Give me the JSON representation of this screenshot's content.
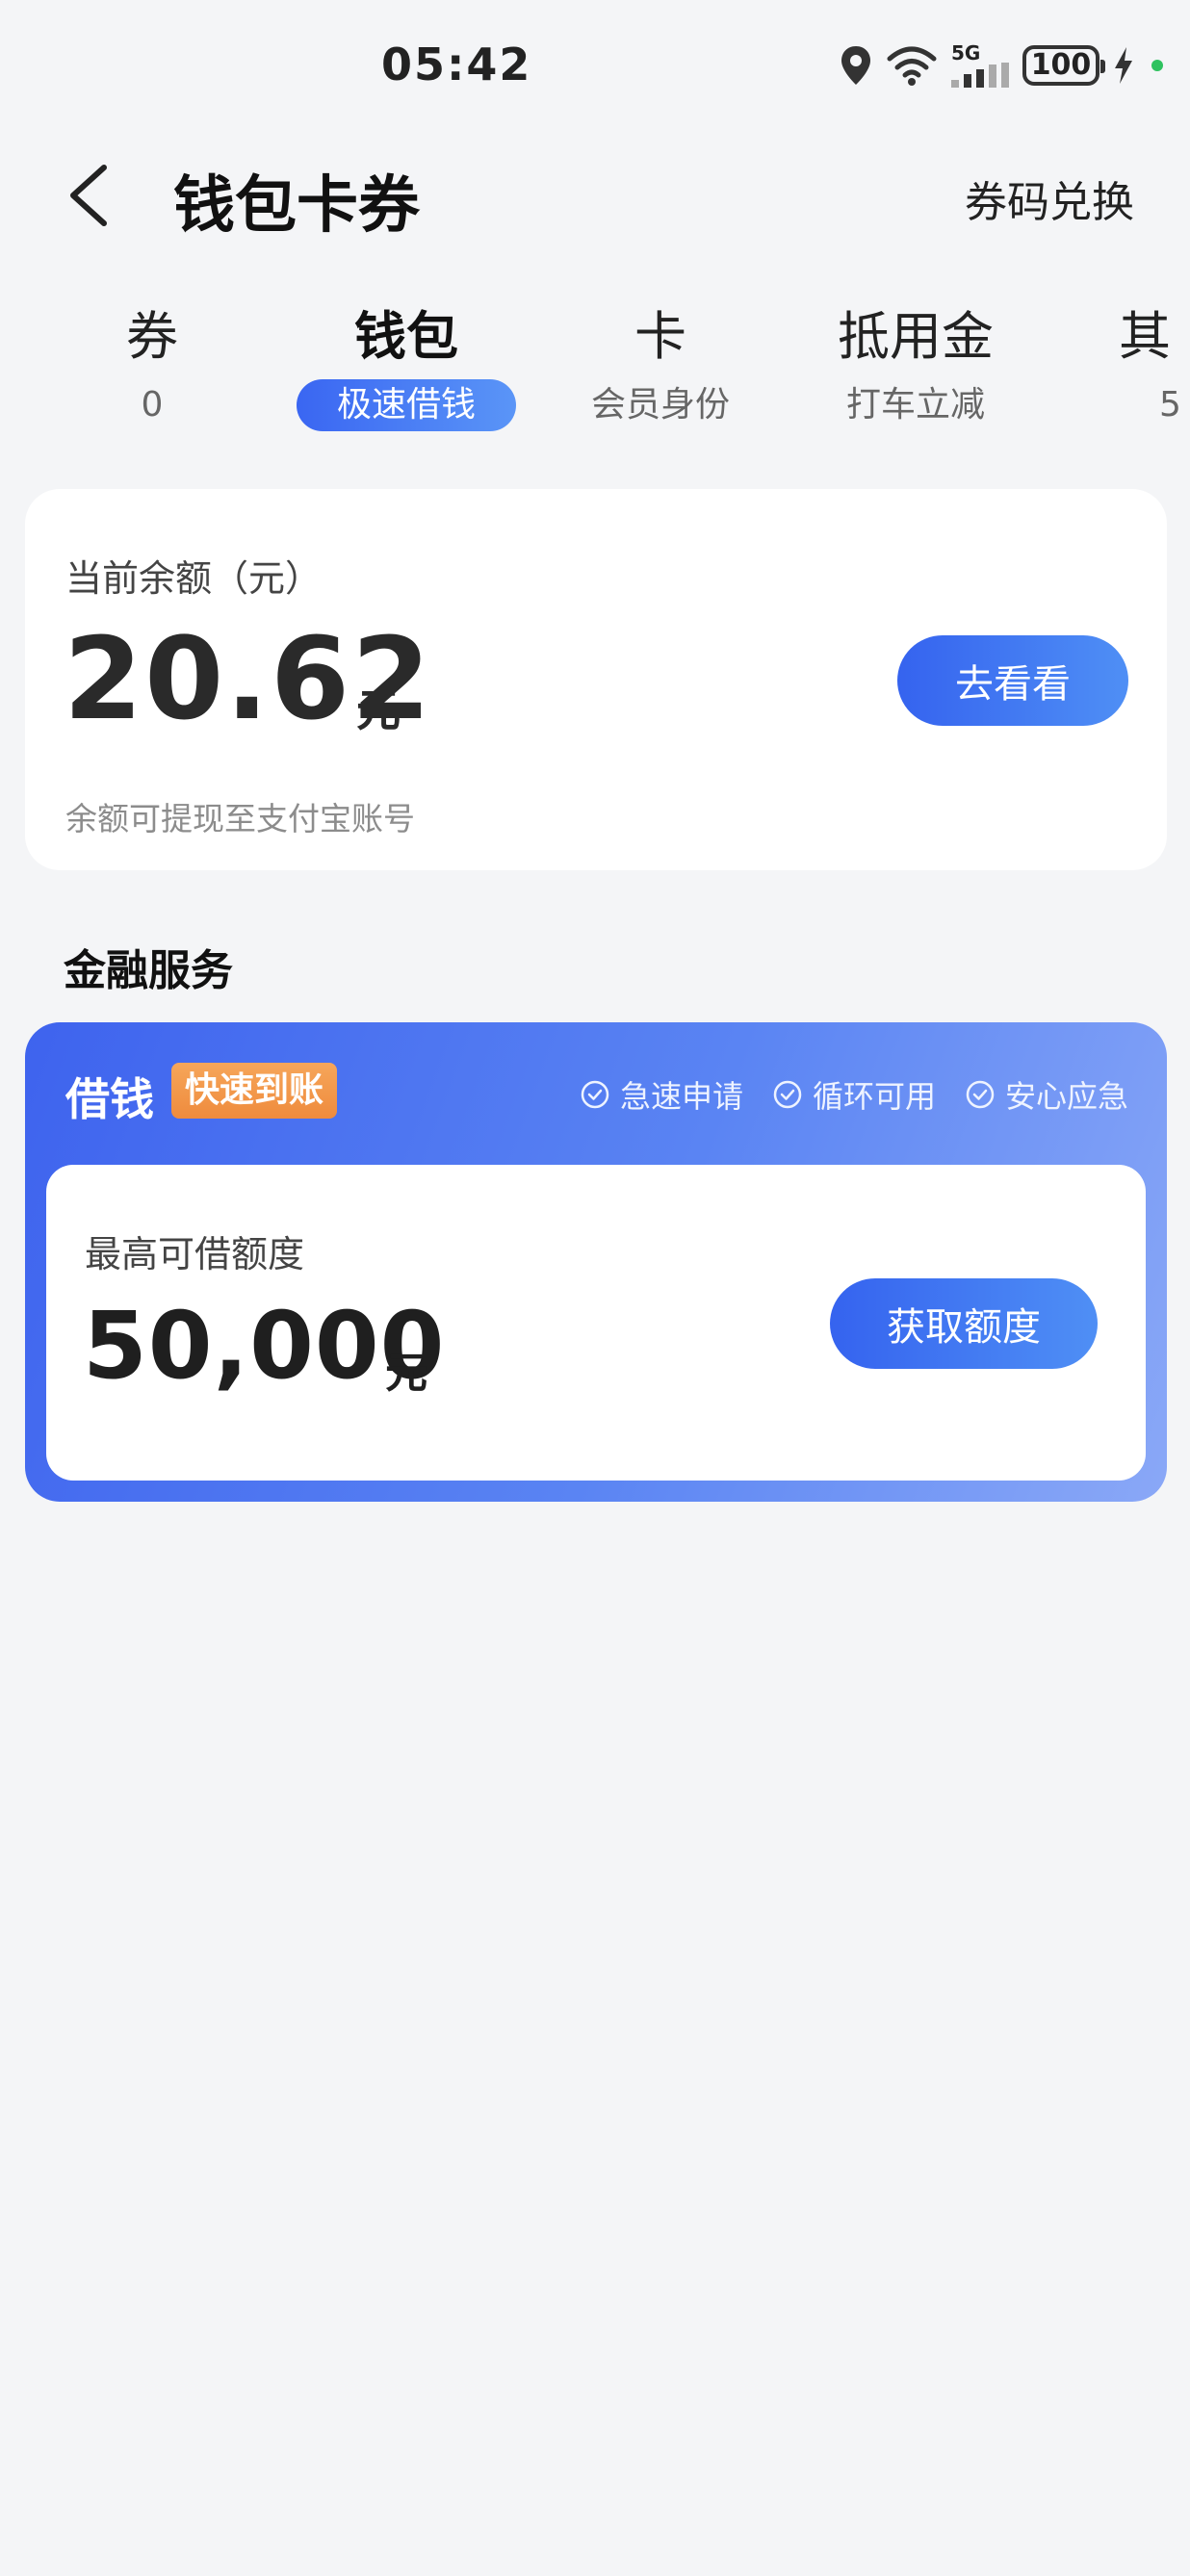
{
  "status_bar": {
    "time": "05:42",
    "network_label": "5G",
    "battery_level": "100",
    "icons": [
      "location-icon",
      "wifi-icon",
      "signal-icon",
      "battery-icon",
      "charging-icon"
    ]
  },
  "header": {
    "title": "钱包卡券",
    "redeem_label": "券码兑换",
    "back_icon": "chevron-left-icon"
  },
  "tabs": [
    {
      "title": "券",
      "sub": "0",
      "active": false
    },
    {
      "title": "钱包",
      "sub": "极速借钱",
      "active": true
    },
    {
      "title": "卡",
      "sub": "会员身份",
      "active": false
    },
    {
      "title": "抵用金",
      "sub": "打车立减",
      "active": false
    },
    {
      "title": "其",
      "sub": "5",
      "active": false
    }
  ],
  "balance": {
    "label": "当前余额（元）",
    "amount": "20.62",
    "unit": "元",
    "note": "余额可提现至支付宝账号",
    "button_label": "去看看"
  },
  "financial_section": {
    "title": "金融服务"
  },
  "loan": {
    "title": "借钱",
    "badge": "快速到账",
    "features": [
      "急速申请",
      "循环可用",
      "安心应急"
    ],
    "limit_label": "最高可借额度",
    "limit_amount": "50,000",
    "limit_unit": "元",
    "button_label": "获取额度"
  },
  "colors": {
    "accent_blue": "#3563ef",
    "badge_orange": "#ef8b3d",
    "page_bg": "#f4f5f7"
  }
}
